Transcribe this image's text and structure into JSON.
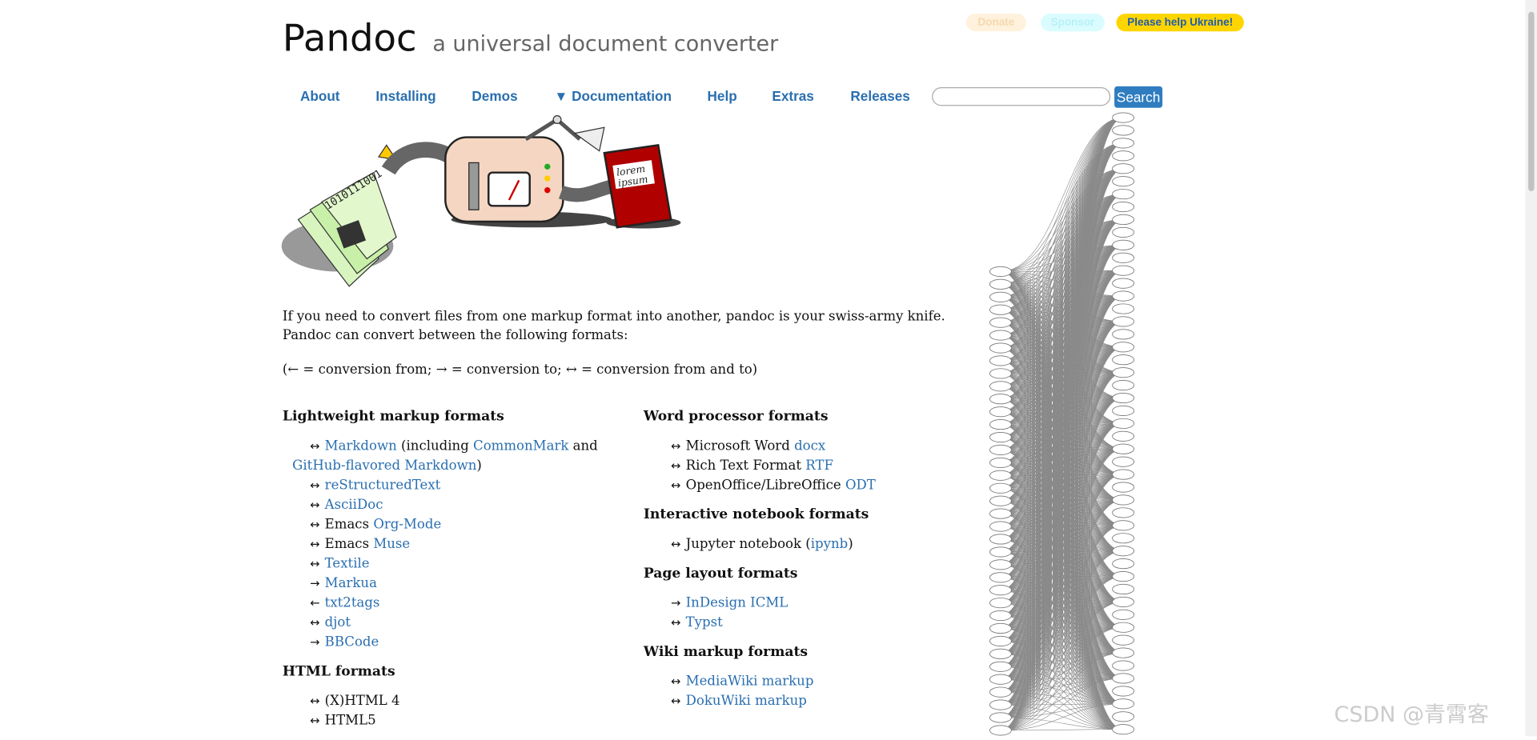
{
  "header": {
    "title": "Pandoc",
    "subtitle": "a universal document converter",
    "buttons": {
      "donate": "Donate",
      "sponsor": "Sponsor",
      "ukraine": "Please help Ukraine!"
    }
  },
  "nav": {
    "items": [
      "About",
      "Installing",
      "Demos",
      "▼ Documentation",
      "Help",
      "Extras",
      "Releases"
    ],
    "search_button": "Search",
    "search_placeholder": ""
  },
  "hero": {
    "book_text": "lorem ipsum",
    "binary_text": "1010111001"
  },
  "intro": {
    "paragraph": "If you need to convert files from one markup format into another, pandoc is your swiss-army knife. Pandoc can convert between the following formats:",
    "legend": "(← = conversion from; → = conversion to; ↔ = conversion from and to)"
  },
  "sections": {
    "lightweight": {
      "heading": "Lightweight markup formats",
      "items": [
        {
          "arrow": "↔",
          "pre": "",
          "link": "Markdown",
          "post": " (including "
        },
        {
          "arrow": "",
          "pre": "",
          "link": "CommonMark",
          "post": " and "
        },
        {
          "arrow": "",
          "pre": "",
          "link": "GitHub-flavored Markdown",
          "post": ")"
        },
        {
          "arrow": "↔",
          "pre": "",
          "link": "reStructuredText",
          "post": ""
        },
        {
          "arrow": "↔",
          "pre": "",
          "link": "AsciiDoc",
          "post": ""
        },
        {
          "arrow": "↔",
          "pre": "Emacs ",
          "link": "Org-Mode",
          "post": ""
        },
        {
          "arrow": "↔",
          "pre": "Emacs ",
          "link": "Muse",
          "post": ""
        },
        {
          "arrow": "↔",
          "pre": "",
          "link": "Textile",
          "post": ""
        },
        {
          "arrow": "→",
          "pre": "",
          "link": "Markua",
          "post": ""
        },
        {
          "arrow": "←",
          "pre": "",
          "link": "txt2tags",
          "post": ""
        },
        {
          "arrow": "↔",
          "pre": "",
          "link": "djot",
          "post": ""
        },
        {
          "arrow": "→",
          "pre": "",
          "link": "BBCode",
          "post": ""
        }
      ]
    },
    "html": {
      "heading": "HTML formats",
      "items": [
        {
          "arrow": "↔",
          "pre": "(X)HTML 4",
          "link": "",
          "post": ""
        },
        {
          "arrow": "↔",
          "pre": "HTML5",
          "link": "",
          "post": ""
        }
      ]
    },
    "word": {
      "heading": "Word processor formats",
      "items": [
        {
          "arrow": "↔",
          "pre": "Microsoft Word ",
          "link": "docx",
          "post": ""
        },
        {
          "arrow": "↔",
          "pre": "Rich Text Format ",
          "link": "RTF",
          "post": ""
        },
        {
          "arrow": "↔",
          "pre": "OpenOffice/LibreOffice ",
          "link": "ODT",
          "post": ""
        }
      ]
    },
    "notebook": {
      "heading": "Interactive notebook formats",
      "items": [
        {
          "arrow": "↔",
          "pre": "Jupyter notebook (",
          "link": "ipynb",
          "post": ")"
        }
      ]
    },
    "layout": {
      "heading": "Page layout formats",
      "items": [
        {
          "arrow": "→",
          "pre": "",
          "link": "InDesign ICML",
          "post": ""
        },
        {
          "arrow": "↔",
          "pre": "",
          "link": "Typst",
          "post": ""
        }
      ]
    },
    "wiki": {
      "heading": "Wiki markup formats",
      "items": [
        {
          "arrow": "↔",
          "pre": "",
          "link": "MediaWiki markup",
          "post": ""
        },
        {
          "arrow": "↔",
          "pre": "",
          "link": "DokuWiki markup",
          "post": ""
        }
      ]
    }
  },
  "watermark": "CSDN @青霄客",
  "colors": {
    "link": "#2a6fb0",
    "ukraine_bg": "#ffd500",
    "donate_bg": "#fff1dc",
    "sponsor_bg": "#dafcff",
    "search_bg": "#2f7dc0"
  }
}
